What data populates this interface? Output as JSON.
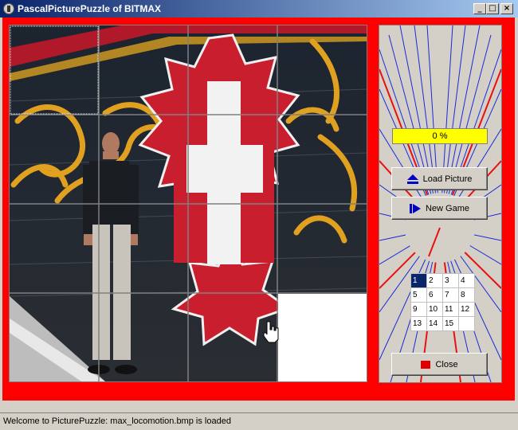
{
  "window": {
    "title": "PascalPicturePuzzle of BITMAX",
    "minimize_symbol": "_",
    "maximize_symbol": "□",
    "close_symbol": "×"
  },
  "panel": {
    "progress_text": "0 %",
    "progress_value": 0,
    "load_picture_label": "Load Picture",
    "load_picture_icon": "eject-icon",
    "new_game_label": "New Game",
    "new_game_icon": "play-next-icon",
    "close_label": "Close",
    "close_icon": "red-square-icon"
  },
  "tile_grid": {
    "rows": [
      [
        "1",
        "2",
        "3",
        "4"
      ],
      [
        "5",
        "6",
        "7",
        "8"
      ],
      [
        "9",
        "10",
        "11",
        "12"
      ],
      [
        "13",
        "14",
        "15",
        ""
      ]
    ],
    "selected": "1"
  },
  "status": {
    "text": "Welcome to PicturePuzzle: max_locomotion.bmp is loaded"
  },
  "colors": {
    "frame": "#ff0000",
    "progress": "#ffff00",
    "titlebar_start": "#0a246a",
    "titlebar_end": "#a6caf0"
  }
}
